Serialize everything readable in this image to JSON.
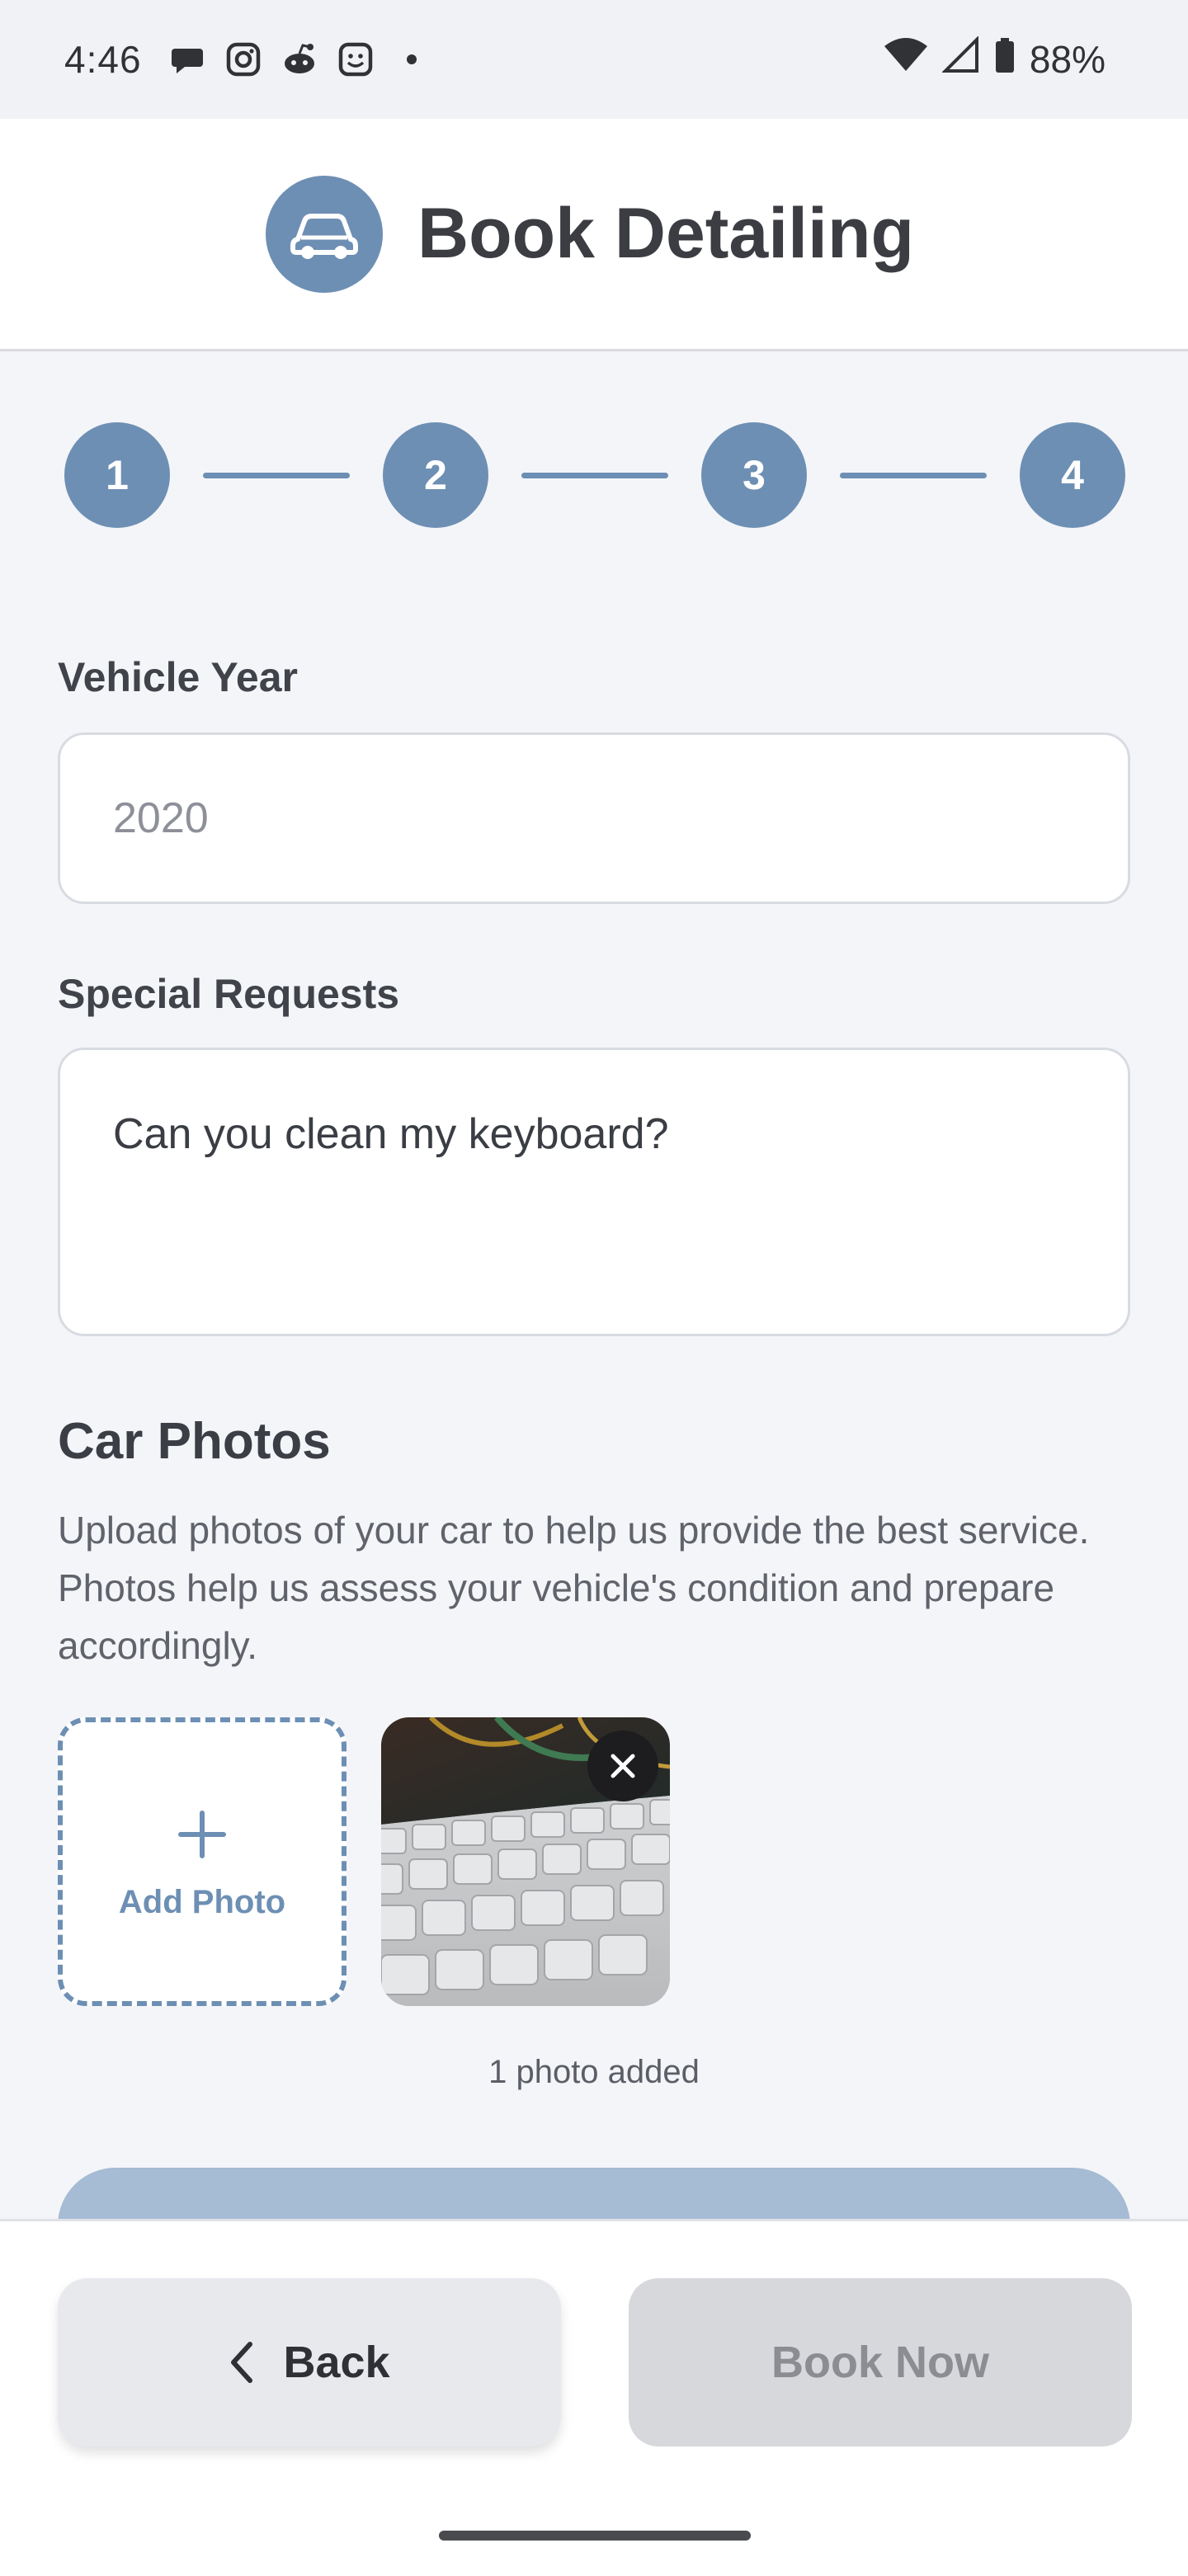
{
  "status_bar": {
    "time": "4:46",
    "icons": [
      "chat-icon",
      "instagram-icon",
      "reddit-icon",
      "smiley-icon",
      "dot-icon"
    ],
    "battery": "88%"
  },
  "header": {
    "title": "Book Detailing",
    "logo_icon": "car-icon"
  },
  "stepper": {
    "steps": [
      "1",
      "2",
      "3",
      "4"
    ]
  },
  "form": {
    "vehicle_year": {
      "label": "Vehicle Year",
      "placeholder": "2020"
    },
    "special_requests": {
      "label": "Special Requests",
      "value": "Can you clean my keyboard?"
    }
  },
  "photos": {
    "title": "Car Photos",
    "description": "Upload photos of your car to help us provide the best service. Photos help us assess your vehicle's condition and prepare accordingly.",
    "add_label": "Add Photo",
    "count_text": "1 photo added"
  },
  "actions": {
    "back_label": "Back",
    "book_label": "Book Now"
  },
  "colors": {
    "accent": "#6d8fb4",
    "disabled_primary": "#a6bbd4",
    "background": "#f4f5f8"
  }
}
